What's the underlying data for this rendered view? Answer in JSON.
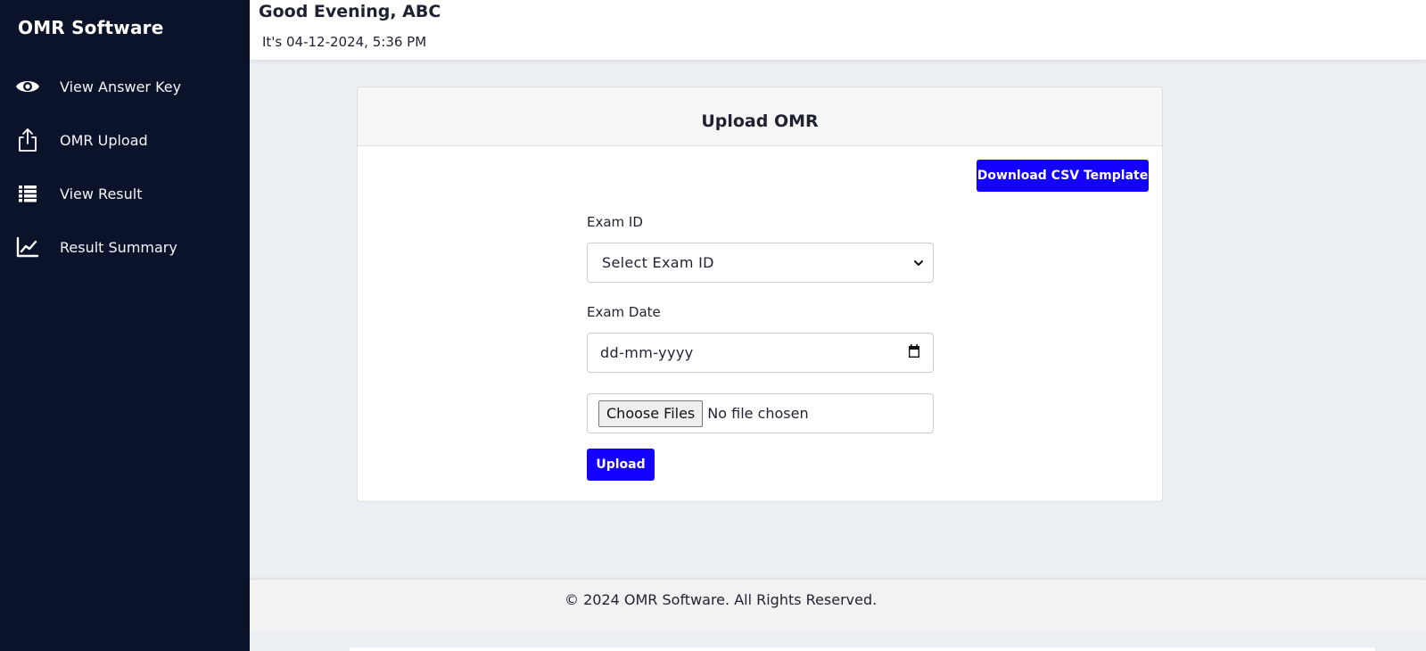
{
  "sidebar": {
    "brand": "OMR Software",
    "items": [
      {
        "label": "View Answer Key",
        "icon": "eye-icon"
      },
      {
        "label": "OMR Upload",
        "icon": "upload-icon"
      },
      {
        "label": "View Result",
        "icon": "list-icon"
      },
      {
        "label": "Result Summary",
        "icon": "chart-line-icon"
      }
    ]
  },
  "header": {
    "greeting": "Good Evening, ABC",
    "datetime": "It's 04-12-2024, 5:36 PM"
  },
  "card": {
    "title": "Upload OMR",
    "download_button": "Download CSV Template",
    "exam_id": {
      "label": "Exam ID",
      "selected": "Select Exam ID"
    },
    "exam_date": {
      "label": "Exam Date",
      "value": "dd-mm-yyyy"
    },
    "file": {
      "button": "Choose Files",
      "status": "No file chosen"
    },
    "upload_button": "Upload"
  },
  "footer": {
    "text": "© 2024 OMR Software. All Rights Reserved."
  },
  "colors": {
    "sidebar_bg": "#0b132b",
    "primary": "#1400ff",
    "page_bg": "#ebeef3"
  }
}
